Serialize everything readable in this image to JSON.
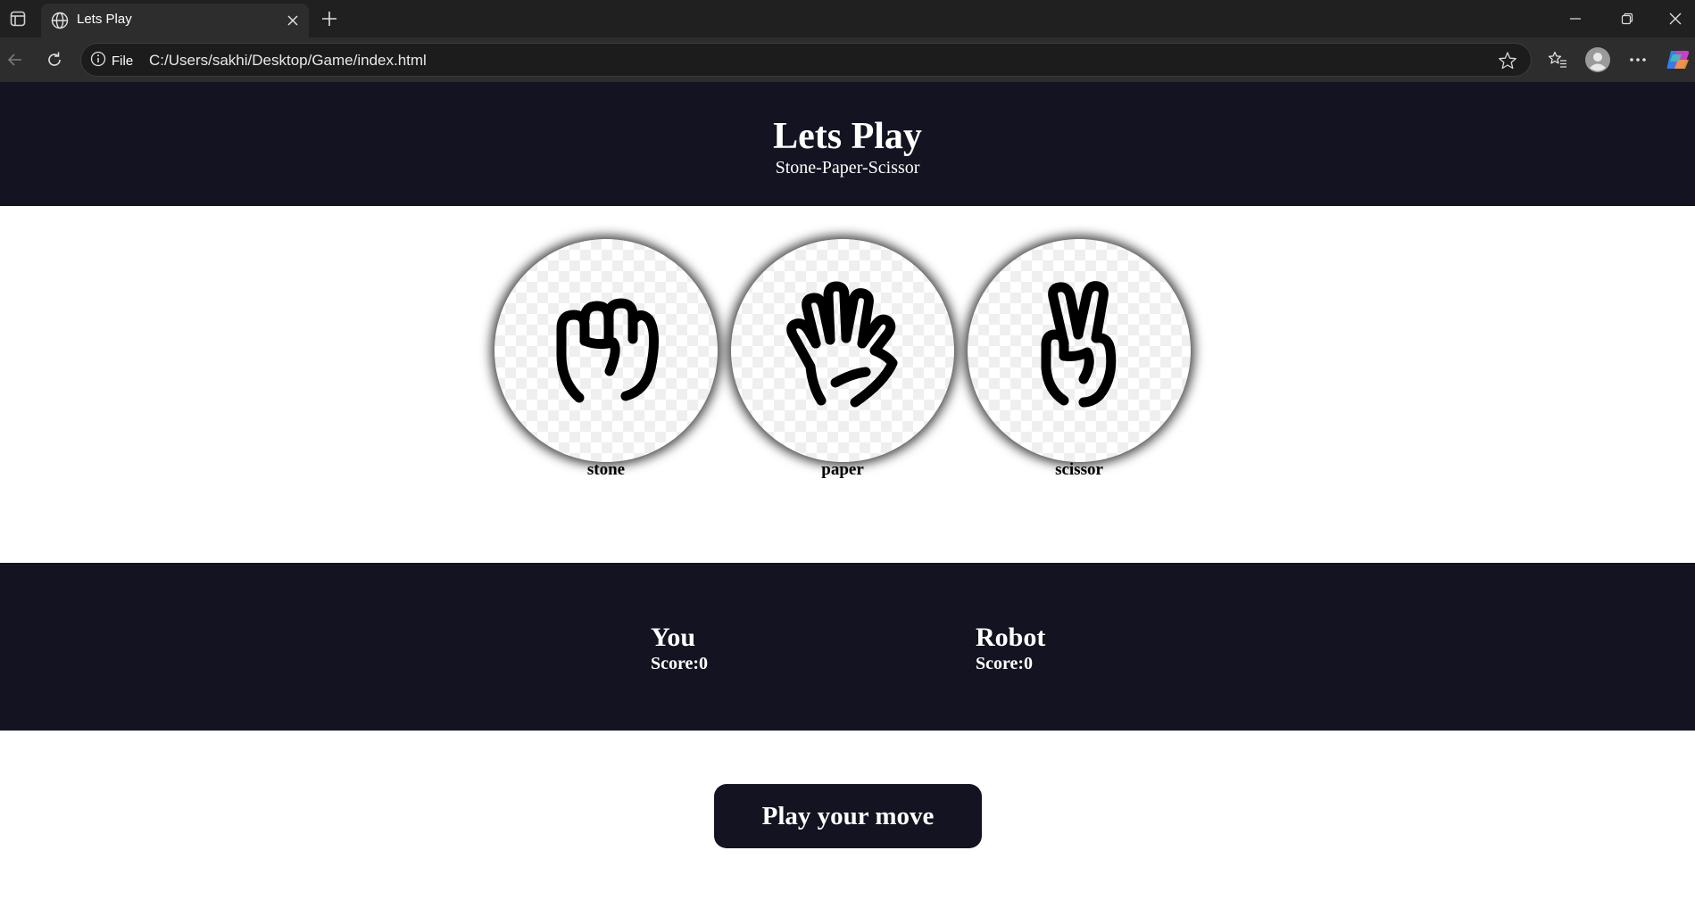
{
  "browser": {
    "tab_title": "Lets Play",
    "site_info_label": "File",
    "url": "C:/Users/sakhi/Desktop/Game/index.html",
    "icons": [
      "tab-sidebar-icon",
      "globe-icon",
      "close-icon",
      "plus-icon",
      "minimize-icon",
      "restore-icon",
      "window-close-icon",
      "back-icon",
      "refresh-icon",
      "info-icon",
      "star-icon",
      "favorites-icon",
      "profile-icon",
      "more-icon",
      "copilot-icon"
    ]
  },
  "header": {
    "title": "Lets Play",
    "subtitle": "Stone-Paper-Scissor"
  },
  "choices": [
    {
      "id": "stone",
      "label": "stone",
      "icon": "fist-icon"
    },
    {
      "id": "paper",
      "label": "paper",
      "icon": "open-hand-icon"
    },
    {
      "id": "scissor",
      "label": "scissor",
      "icon": "peace-hand-icon"
    }
  ],
  "scoreboard": {
    "you": {
      "name": "You",
      "score": "Score:0"
    },
    "robot": {
      "name": "Robot",
      "score": "Score:0"
    }
  },
  "play_button": {
    "label": "Play your move"
  },
  "colors": {
    "dark_band": "#131321",
    "chrome_bg": "#202020",
    "tab_bg": "#2d2d2d"
  }
}
